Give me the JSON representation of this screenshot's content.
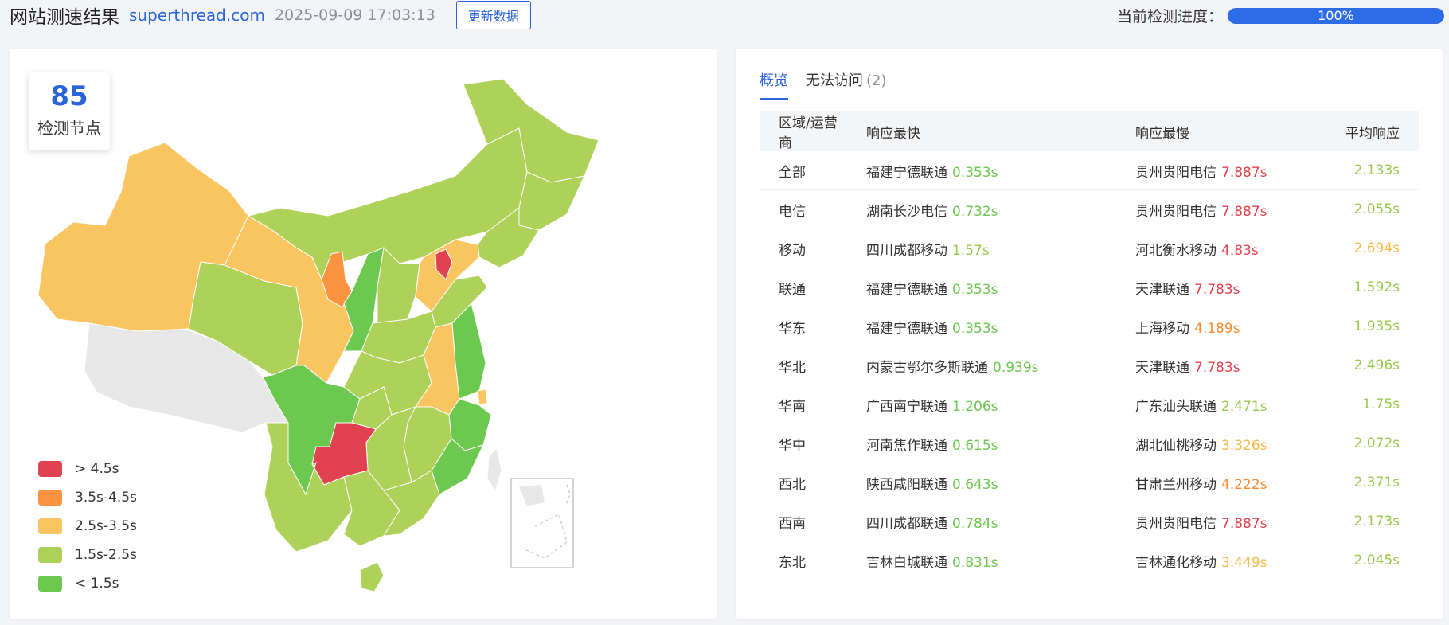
{
  "header": {
    "title": "网站测速结果",
    "domain": "superthread.com",
    "datetime": "2025-09-09 17:03:13",
    "refresh_label": "更新数据",
    "progress_label": "当前检测进度：",
    "progress_text": "100%",
    "progress_value": 1.0
  },
  "colors": {
    "accent": "#2b63d8",
    "red": "#e0434f",
    "orange": "#fa9440",
    "yellow": "#f8c560",
    "lightgreen": "#aed15a",
    "green": "#6cc84f"
  },
  "map_panel": {
    "node_count": "85",
    "node_label": "检测节点",
    "legend": [
      {
        "label": "> 4.5s",
        "color": "#e0434f"
      },
      {
        "label": "3.5s-4.5s",
        "color": "#fa9440"
      },
      {
        "label": "2.5s-3.5s",
        "color": "#f8c560"
      },
      {
        "label": "1.5s-2.5s",
        "color": "#aed15a"
      },
      {
        "label": "< 1.5s",
        "color": "#6cc84f"
      }
    ]
  },
  "table_panel": {
    "tabs": [
      {
        "label": "概览",
        "active": true,
        "count": ""
      },
      {
        "label": "无法访问",
        "active": false,
        "count": "(2)"
      }
    ],
    "columns": [
      "区域/运营商",
      "响应最快",
      "响应最慢",
      "平均响应"
    ],
    "rows": [
      {
        "region": "全部",
        "fast_name": "福建宁德联通",
        "fast_time": "0.353s",
        "fast_color": "#6cc84f",
        "slow_name": "贵州贵阳电信",
        "slow_time": "7.887s",
        "slow_color": "#e0434f",
        "avg": "2.133s",
        "avg_color": "#99c94c"
      },
      {
        "region": "电信",
        "fast_name": "湖南长沙电信",
        "fast_time": "0.732s",
        "fast_color": "#6cc84f",
        "slow_name": "贵州贵阳电信",
        "slow_time": "7.887s",
        "slow_color": "#e0434f",
        "avg": "2.055s",
        "avg_color": "#99c94c"
      },
      {
        "region": "移动",
        "fast_name": "四川成都移动",
        "fast_time": "1.57s",
        "fast_color": "#99c94c",
        "slow_name": "河北衡水移动",
        "slow_time": "4.83s",
        "slow_color": "#e0434f",
        "avg": "2.694s",
        "avg_color": "#f5b94a"
      },
      {
        "region": "联通",
        "fast_name": "福建宁德联通",
        "fast_time": "0.353s",
        "fast_color": "#6cc84f",
        "slow_name": "天津联通",
        "slow_time": "7.783s",
        "slow_color": "#e0434f",
        "avg": "1.592s",
        "avg_color": "#99c94c"
      },
      {
        "region": "华东",
        "fast_name": "福建宁德联通",
        "fast_time": "0.353s",
        "fast_color": "#6cc84f",
        "slow_name": "上海移动",
        "slow_time": "4.189s",
        "slow_color": "#fa8a2e",
        "avg": "1.935s",
        "avg_color": "#99c94c"
      },
      {
        "region": "华北",
        "fast_name": "内蒙古鄂尔多斯联通",
        "fast_time": "0.939s",
        "fast_color": "#6cc84f",
        "slow_name": "天津联通",
        "slow_time": "7.783s",
        "slow_color": "#e0434f",
        "avg": "2.496s",
        "avg_color": "#99c94c"
      },
      {
        "region": "华南",
        "fast_name": "广西南宁联通",
        "fast_time": "1.206s",
        "fast_color": "#6cc84f",
        "slow_name": "广东汕头联通",
        "slow_time": "2.471s",
        "slow_color": "#99c94c",
        "avg": "1.75s",
        "avg_color": "#99c94c"
      },
      {
        "region": "华中",
        "fast_name": "河南焦作联通",
        "fast_time": "0.615s",
        "fast_color": "#6cc84f",
        "slow_name": "湖北仙桃移动",
        "slow_time": "3.326s",
        "slow_color": "#f5b94a",
        "avg": "2.072s",
        "avg_color": "#99c94c"
      },
      {
        "region": "西北",
        "fast_name": "陕西咸阳联通",
        "fast_time": "0.643s",
        "fast_color": "#6cc84f",
        "slow_name": "甘肃兰州移动",
        "slow_time": "4.222s",
        "slow_color": "#fa8a2e",
        "avg": "2.371s",
        "avg_color": "#99c94c"
      },
      {
        "region": "西南",
        "fast_name": "四川成都联通",
        "fast_time": "0.784s",
        "fast_color": "#6cc84f",
        "slow_name": "贵州贵阳电信",
        "slow_time": "7.887s",
        "slow_color": "#e0434f",
        "avg": "2.173s",
        "avg_color": "#99c94c"
      },
      {
        "region": "东北",
        "fast_name": "吉林白城联通",
        "fast_time": "0.831s",
        "fast_color": "#6cc84f",
        "slow_name": "吉林通化移动",
        "slow_time": "3.449s",
        "slow_color": "#f5b94a",
        "avg": "2.045s",
        "avg_color": "#99c94c"
      }
    ]
  }
}
